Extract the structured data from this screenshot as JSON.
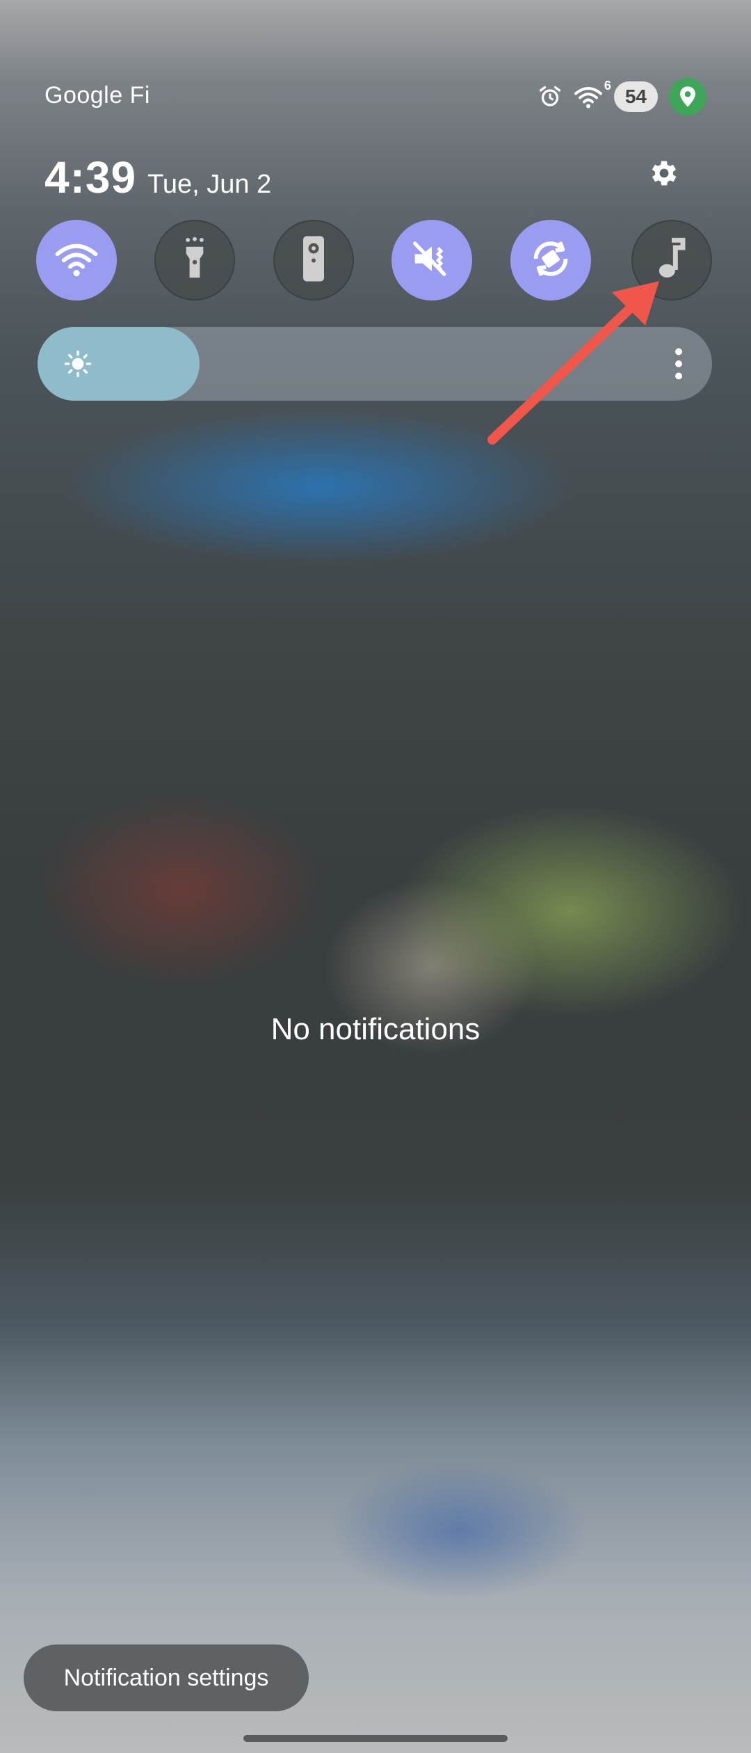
{
  "status_bar": {
    "carrier": "Google Fi",
    "wifi_badge": "6",
    "battery_level": "54",
    "icons": [
      "alarm-icon",
      "wifi-icon",
      "battery-indicator",
      "location-icon"
    ]
  },
  "header": {
    "time": "4:39",
    "date": "Tue, Jun 2",
    "settings_icon": "gear-icon"
  },
  "quick_tiles": [
    {
      "name": "wifi",
      "icon": "wifi-icon",
      "state": "on"
    },
    {
      "name": "flashlight",
      "icon": "flashlight-icon",
      "state": "off"
    },
    {
      "name": "remote",
      "icon": "remote-icon",
      "state": "off"
    },
    {
      "name": "mute",
      "icon": "mute-icon",
      "state": "on"
    },
    {
      "name": "auto-rotate",
      "icon": "rotate-icon",
      "state": "on"
    },
    {
      "name": "music",
      "icon": "music-note-icon",
      "state": "off"
    }
  ],
  "brightness": {
    "level": 0.24,
    "more_icon": "more-vertical-icon"
  },
  "main": {
    "empty_message": "No notifications"
  },
  "footer": {
    "notification_settings_label": "Notification settings"
  },
  "colors": {
    "tile_on": "#9a9cf2",
    "brightness_fill": "#8fbccb",
    "annotation_arrow": "#f0574a",
    "location_green": "#3fa659"
  }
}
